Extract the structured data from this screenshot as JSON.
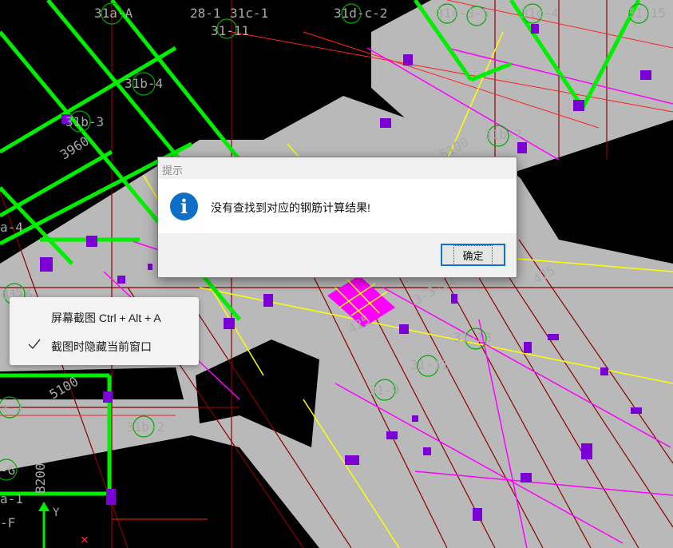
{
  "drawing": {
    "axis_labels": [
      "31a-A",
      "28-1",
      "31c-1",
      "31d-c-2",
      "31c-3-5",
      "31c-4",
      "31-15",
      "31-11",
      "31b-4",
      "31b-3",
      "3960",
      "31b-7",
      "5100",
      "31-6",
      "475",
      "3-3-22",
      "31-13",
      "31-11",
      "31-9",
      "31b-2",
      "5100",
      "B200",
      "a-4",
      "a-5",
      "a-2",
      "-G",
      "a-1",
      "-F",
      "425",
      "Y"
    ],
    "colors": {
      "background": "#000000",
      "slab": "#b9b9b9",
      "beam": "#00ee00",
      "axis": "#8b0000",
      "grid_red": "#ff0000",
      "yellow": "#ffff00",
      "magenta": "#ff00ff",
      "column": "#7b00d6",
      "label": "#a8a8a8"
    }
  },
  "dialog": {
    "title": "提示",
    "icon": "info-icon",
    "message": "没有查找到对应的钢筋计算结果!",
    "ok_label": "确定"
  },
  "context_menu": {
    "items": [
      {
        "label": "屏幕截图 Ctrl + Alt + A",
        "checked": false
      },
      {
        "label": "截图时隐藏当前窗口",
        "checked": true
      }
    ]
  }
}
